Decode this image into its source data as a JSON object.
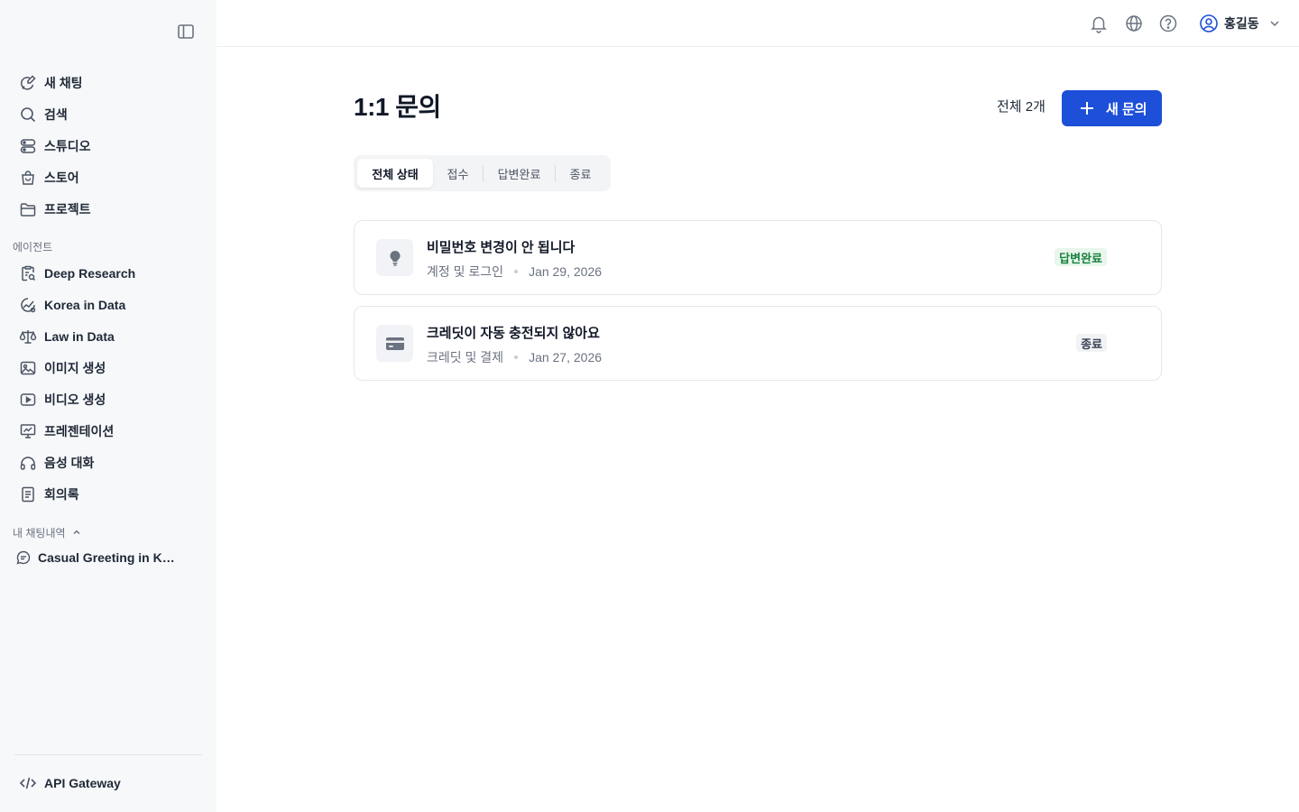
{
  "sidebar": {
    "nav": [
      {
        "label": "새 채팅",
        "icon": "new-chat-icon"
      },
      {
        "label": "검색",
        "icon": "search-icon"
      },
      {
        "label": "스튜디오",
        "icon": "studio-icon"
      },
      {
        "label": "스토어",
        "icon": "store-bag-icon"
      },
      {
        "label": "프로젝트",
        "icon": "folder-icon"
      }
    ],
    "agents_label": "에이전트",
    "agents": [
      {
        "label": "Deep Research",
        "icon": "research-clipboard-icon"
      },
      {
        "label": "Korea in Data",
        "icon": "data-chart-icon"
      },
      {
        "label": "Law in Data",
        "icon": "scale-icon"
      },
      {
        "label": "이미지 생성",
        "icon": "image-icon"
      },
      {
        "label": "비디오 생성",
        "icon": "video-icon"
      },
      {
        "label": "프레젠테이션",
        "icon": "presentation-icon"
      },
      {
        "label": "음성 대화",
        "icon": "headphones-icon"
      },
      {
        "label": "회의록",
        "icon": "notes-icon"
      }
    ],
    "history_label": "내 채팅내역",
    "history": [
      {
        "label": "Casual Greeting in Korean",
        "icon": "chat-bubble-icon"
      }
    ],
    "api_label": "API Gateway"
  },
  "header": {
    "user_name": "홍길동"
  },
  "main": {
    "title": "1:1 문의",
    "total": "전체 2개",
    "new_button": "새 문의",
    "tabs": [
      "전체 상태",
      "접수",
      "답변완료",
      "종료"
    ],
    "inquiries": [
      {
        "title": "비밀번호 변경이 안 됩니다",
        "category": "계정 및 로그인",
        "date": "Jan 29, 2026",
        "status": "답변완료",
        "icon": "lightbulb-icon"
      },
      {
        "title": "크레딧이 자동 충전되지 않아요",
        "category": "크레딧 및 결제",
        "date": "Jan 27, 2026",
        "status": "종료",
        "icon": "credit-card-icon"
      }
    ]
  },
  "colors": {
    "primary": "#1d4fd8",
    "sidebar_bg": "#f7f8fa",
    "status_done_bg": "#e9f6ec",
    "status_done_fg": "#16803c",
    "status_closed_bg": "#f1f3f5"
  }
}
